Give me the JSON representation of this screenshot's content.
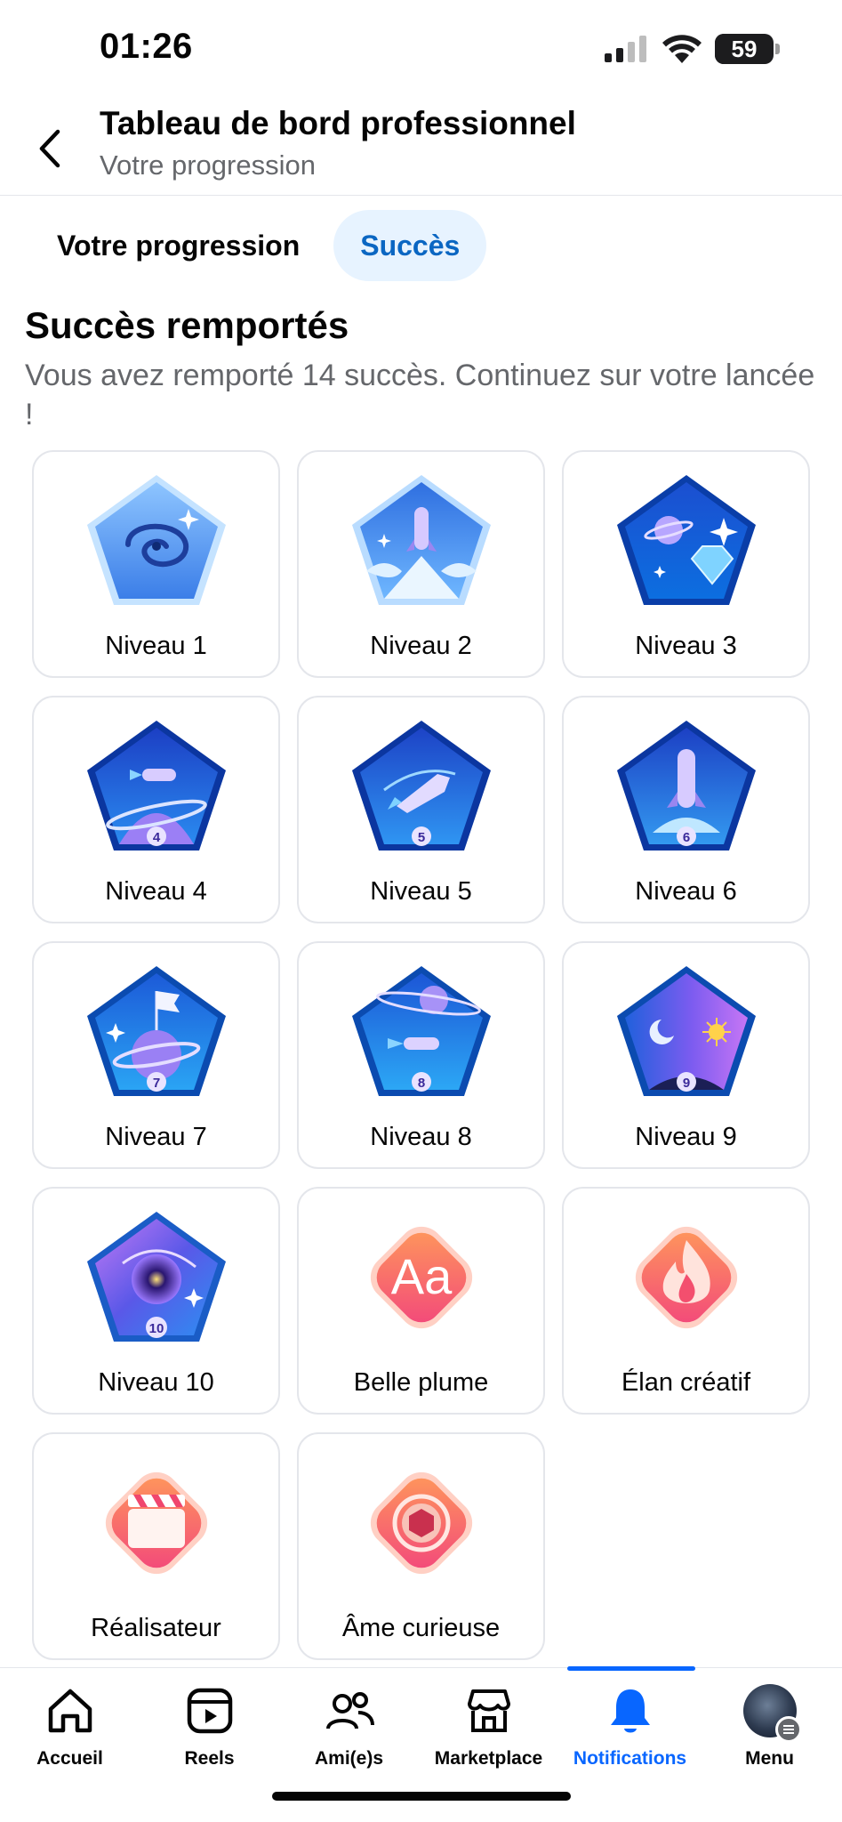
{
  "status_bar": {
    "time": "01:26",
    "battery": "59"
  },
  "header": {
    "title": "Tableau de bord professionnel",
    "subtitle": "Votre progression"
  },
  "tabs": [
    {
      "label": "Votre progression",
      "active": false
    },
    {
      "label": "Succès",
      "active": true
    }
  ],
  "section": {
    "title": "Succès remportés",
    "description": "Vous avez remporté 14 succès. Continuez sur votre lancée !"
  },
  "achievements": [
    {
      "label": "Niveau 1",
      "icon": "galaxy-pentagon-icon",
      "number": ""
    },
    {
      "label": "Niveau 2",
      "icon": "rocket-launch-pentagon-icon",
      "number": ""
    },
    {
      "label": "Niveau 3",
      "icon": "planet-diamond-pentagon-icon",
      "number": ""
    },
    {
      "label": "Niveau 4",
      "icon": "shuttle-planet-pentagon-icon",
      "number": "4"
    },
    {
      "label": "Niveau 5",
      "icon": "spaceship-pentagon-icon",
      "number": "5"
    },
    {
      "label": "Niveau 6",
      "icon": "rocket-pentagon-icon",
      "number": "6"
    },
    {
      "label": "Niveau 7",
      "icon": "flag-planet-pentagon-icon",
      "number": "7"
    },
    {
      "label": "Niveau 8",
      "icon": "shuttle-ring-pentagon-icon",
      "number": "8"
    },
    {
      "label": "Niveau 9",
      "icon": "moon-star-pentagon-icon",
      "number": "9"
    },
    {
      "label": "Niveau 10",
      "icon": "black-hole-pentagon-icon",
      "number": "10"
    },
    {
      "label": "Belle plume",
      "icon": "font-aa-icon",
      "text": "Aa"
    },
    {
      "label": "Élan créatif",
      "icon": "flame-icon"
    },
    {
      "label": "Réalisateur",
      "icon": "clapperboard-icon"
    },
    {
      "label": "Âme curieuse",
      "icon": "camera-lens-icon"
    }
  ],
  "bottom_nav": [
    {
      "label": "Accueil",
      "icon": "home-icon",
      "active": false
    },
    {
      "label": "Reels",
      "icon": "reels-icon",
      "active": false
    },
    {
      "label": "Ami(e)s",
      "icon": "friends-icon",
      "active": false
    },
    {
      "label": "Marketplace",
      "icon": "marketplace-icon",
      "active": false
    },
    {
      "label": "Notifications",
      "icon": "bell-icon",
      "active": true
    },
    {
      "label": "Menu",
      "icon": "avatar-icon",
      "active": false
    }
  ],
  "colors": {
    "accent": "#0866ff",
    "tab_active_bg": "#e7f3ff",
    "tab_active_text": "#0a66c2",
    "muted": "#65676b"
  }
}
